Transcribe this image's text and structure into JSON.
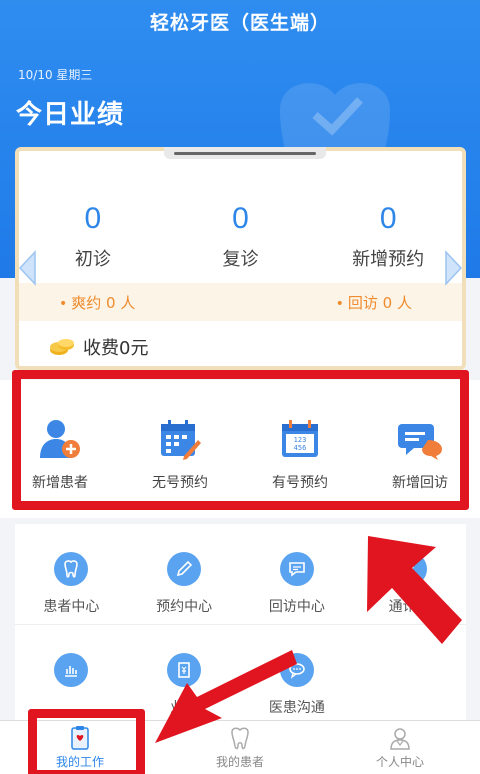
{
  "header": {
    "title": "轻松牙医（医生端）",
    "date": "10/10 星期三",
    "section_title": "今日业绩"
  },
  "stats": [
    {
      "value": "0",
      "label": "初诊"
    },
    {
      "value": "0",
      "label": "复诊"
    },
    {
      "value": "0",
      "label": "新增预约"
    }
  ],
  "reminders": {
    "missed": "爽约 0 人",
    "followup": "回访 0 人"
  },
  "fee": "收费0元",
  "quick_actions": [
    {
      "label": "新增患者",
      "icon": "add-patient-icon"
    },
    {
      "label": "无号预约",
      "icon": "calendar-edit-icon"
    },
    {
      "label": "有号预约",
      "icon": "calendar-number-icon"
    },
    {
      "label": "新增回访",
      "icon": "chat-bubble-icon"
    }
  ],
  "modules": [
    {
      "label": "患者中心",
      "icon": "tooth-icon"
    },
    {
      "label": "预约中心",
      "icon": "pencil-icon"
    },
    {
      "label": "回访中心",
      "icon": "chat-icon"
    },
    {
      "label": "通讯录",
      "icon": "contacts-icon"
    },
    {
      "label": "",
      "icon": "bar-chart-icon"
    },
    {
      "label": "业绩",
      "icon": "receipt-icon"
    },
    {
      "label": "医患沟通",
      "icon": "message-icon"
    }
  ],
  "tabbar": [
    {
      "label": "我的工作",
      "active": true
    },
    {
      "label": "我的患者",
      "active": false
    },
    {
      "label": "个人中心",
      "active": false
    }
  ],
  "colors": {
    "primary": "#2d86e8",
    "accent_orange": "#ef8b2c",
    "highlight_red": "#e0151f"
  }
}
